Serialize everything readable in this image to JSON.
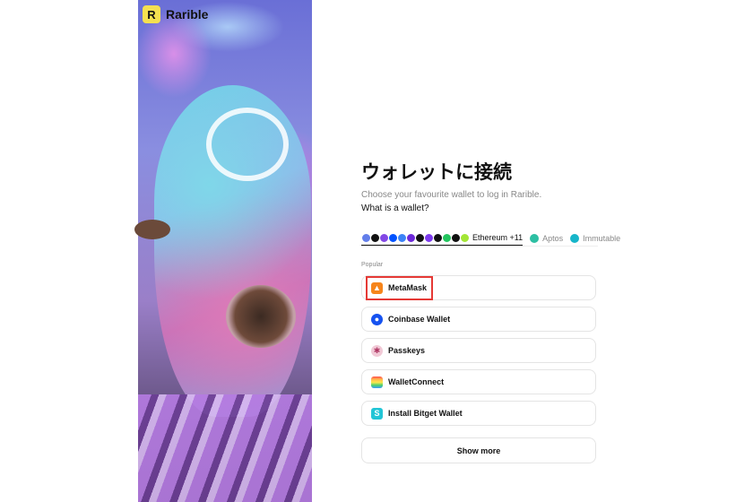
{
  "brand": {
    "name": "Rarible",
    "icon": "rarible-logo-icon",
    "accent": "#f5e050"
  },
  "main": {
    "title": "ウォレットに接続",
    "subtitle": "Choose your favourite wallet to log in Rarible.",
    "what_is": "What is a wallet?"
  },
  "tabs": [
    {
      "label": "Ethereum +11",
      "active": true
    },
    {
      "label": "Aptos",
      "icon": "aptos-icon",
      "color": "#2dbfa3"
    },
    {
      "label": "Immutable",
      "icon": "immutable-icon",
      "color": "#17b5c9"
    }
  ],
  "section_label": "Popular",
  "wallets": [
    {
      "label": "MetaMask",
      "icon": "metamask-fox-icon",
      "color": "#f6851b"
    },
    {
      "label": "Coinbase Wallet",
      "icon": "coinbase-icon",
      "color": "#1652f0"
    },
    {
      "label": "Passkeys",
      "icon": "passkeys-icon",
      "color": "#f1c9d6"
    },
    {
      "label": "WalletConnect",
      "icon": "walletconnect-rainbow-icon",
      "color": "#3b99fc"
    },
    {
      "label": "Install Bitget Wallet",
      "icon": "bitget-icon",
      "color": "#22c5d6"
    }
  ],
  "show_more": "Show more"
}
